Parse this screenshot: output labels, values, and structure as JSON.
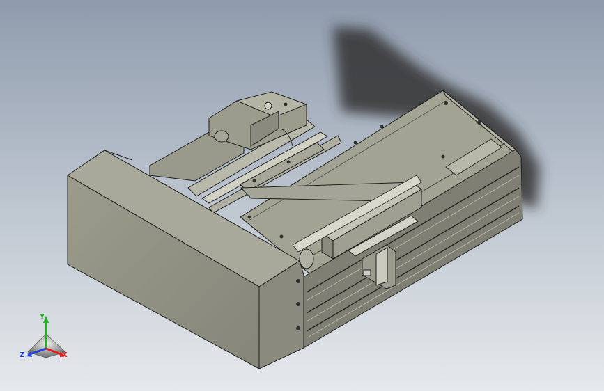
{
  "view": {
    "background_top": "#8f9bad",
    "background_bottom": "#e6e9ec",
    "model_color": "#8d8d7f",
    "shadow_color": "#3a3a3a"
  },
  "triad": {
    "x_label": "X",
    "y_label": "Y",
    "z_label": "Z",
    "x_color": "#e02020",
    "y_color": "#20b020",
    "z_color": "#2040e0"
  }
}
